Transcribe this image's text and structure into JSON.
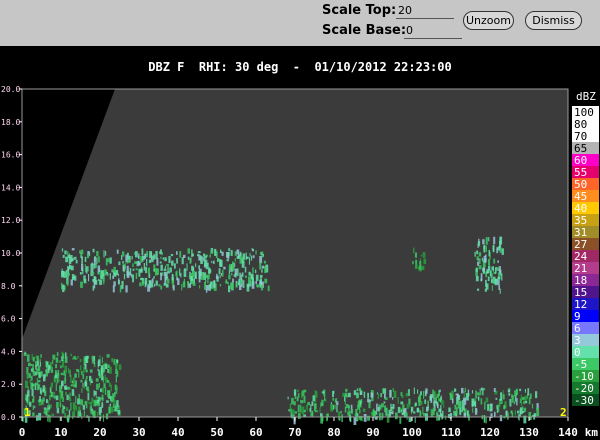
{
  "toolbar": {
    "scale_top_label": "Scale Top:",
    "scale_top_value": "20",
    "scale_base_label": "Scale Base:",
    "scale_base_value": "0",
    "unzoom_label": "Unzoom",
    "dismiss_label": "Dismiss"
  },
  "title": "DBZ F  RHI: 30 deg  -  01/10/2012 22:23:00",
  "chart_data": {
    "type": "heatmap",
    "title": "DBZ F  RHI: 30 deg  -  01/10/2012 22:23:00",
    "x_unit": "km",
    "xlim": [
      0,
      140
    ],
    "ylim": [
      0,
      20
    ],
    "x_ticks": [
      "0",
      "10",
      "20",
      "30",
      "40",
      "50",
      "60",
      "70",
      "80",
      "90",
      "100",
      "110",
      "120",
      "130",
      "140"
    ],
    "y_ticks": [
      "0.0",
      "2.0",
      "4.0",
      "6.0",
      "8.0",
      "10.0",
      "12.0",
      "14.0",
      "16.0",
      "18.0",
      "20.0"
    ],
    "corner_markers": [
      "1",
      "2"
    ],
    "colorbar": {
      "unit": "dBZ",
      "labels": [
        "100",
        "80",
        "70",
        "65",
        "60",
        "55",
        "50",
        "45",
        "40",
        "35",
        "31",
        "27",
        "24",
        "21",
        "18",
        "15",
        "12",
        "9",
        "6",
        "3",
        "0",
        "-5",
        "-10",
        "-20",
        "-30"
      ],
      "colors": [
        "#ffffff",
        "#ffffff",
        "#ffffff",
        "#b4b4b4",
        "#ff00c8",
        "#e6006e",
        "#ff6428",
        "#ff8c1e",
        "#ffc800",
        "#c8a014",
        "#a08c28",
        "#8c5028",
        "#a02864",
        "#b43c8c",
        "#8c2896",
        "#50148c",
        "#1e14c8",
        "#0000ff",
        "#7878ff",
        "#96c8dc",
        "#64e1aa",
        "#3cc864",
        "#28a03c",
        "#14782d",
        "#0a501e"
      ]
    },
    "echo_regions": [
      {
        "x0": 10,
        "x1": 63,
        "y0": 8.0,
        "y1": 10.3,
        "dbz": [
          -5,
          3
        ],
        "note": "layer"
      },
      {
        "x0": 100,
        "x1": 103,
        "y0": 8.8,
        "y1": 10.4,
        "dbz": [
          -10,
          -5
        ]
      },
      {
        "x0": 116,
        "x1": 123,
        "y0": 7.8,
        "y1": 11.0,
        "dbz": [
          -5,
          3
        ]
      },
      {
        "x0": 68,
        "x1": 132,
        "y0": 0.0,
        "y1": 1.8,
        "dbz": [
          -10,
          3
        ]
      },
      {
        "x0": 0,
        "x1": 25,
        "y0": 0.0,
        "y1": 4.0,
        "dbz": [
          -10,
          0
        ]
      }
    ]
  }
}
